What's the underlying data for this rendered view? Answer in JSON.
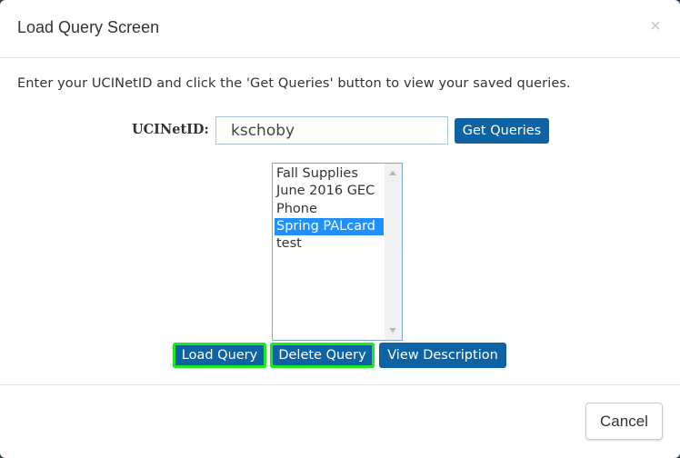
{
  "dialog": {
    "title": "Load Query Screen",
    "close_label": "×",
    "intro": "Enter your UCINetID and click the 'Get Queries' button to view your saved queries."
  },
  "form": {
    "ucinetid_label": "UCINetID:",
    "ucinetid_value": "kschoby",
    "get_queries_label": "Get Queries"
  },
  "queries": {
    "items": [
      "Fall Supplies",
      "June 2016 GEC",
      "Phone",
      "Spring PALcard",
      "test"
    ],
    "selected": "Spring PALcard"
  },
  "actions": {
    "load_label": "Load Query",
    "delete_label": "Delete Query",
    "view_label": "View Description"
  },
  "footer": {
    "cancel_label": "Cancel"
  },
  "colors": {
    "primary": "#0e63a4",
    "highlight_outline": "#1ee81e",
    "selection": "#1e90ff"
  }
}
